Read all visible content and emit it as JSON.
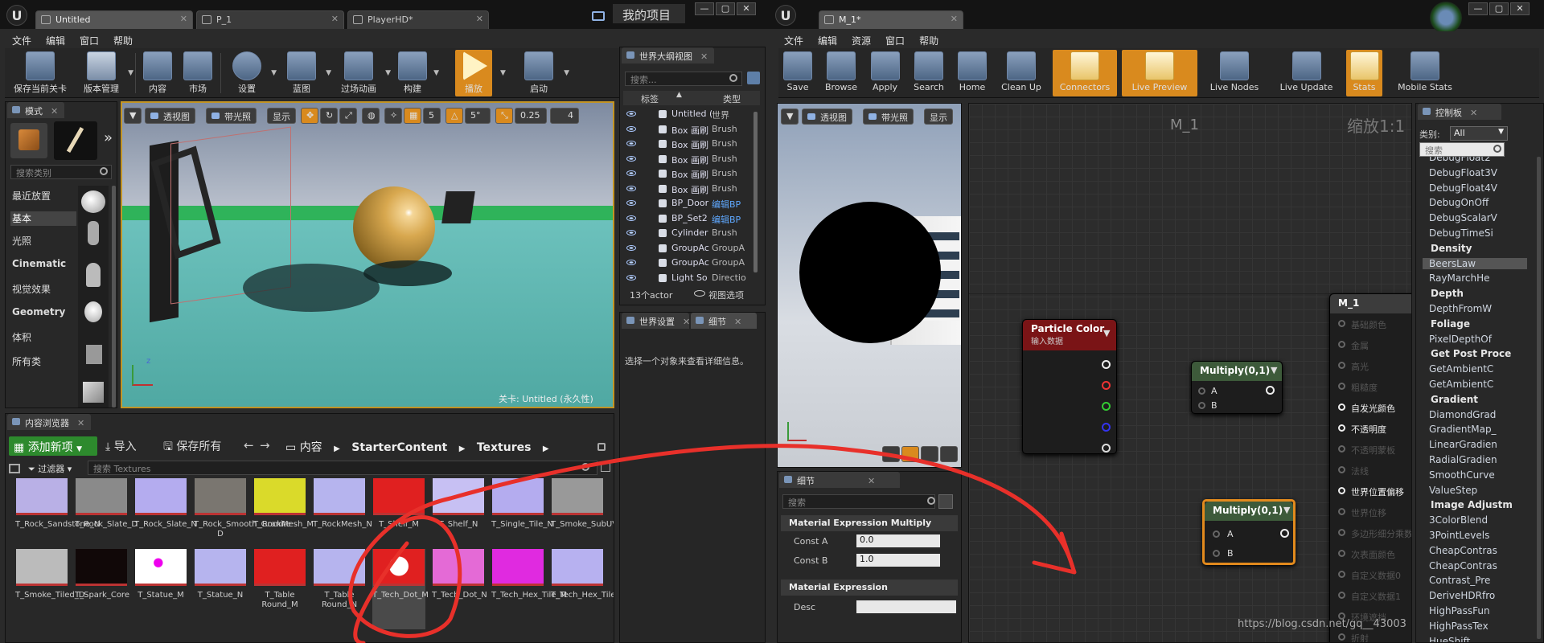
{
  "left_window": {
    "tabs": [
      "Untitled",
      "P_1",
      "PlayerHD*"
    ],
    "project_label": "我的项目",
    "menu": [
      "文件",
      "编辑",
      "窗口",
      "帮助"
    ],
    "toolbar": [
      "保存当前关卡",
      "版本管理",
      "内容",
      "市场",
      "设置",
      "蓝图",
      "过场动画",
      "构建",
      "播放",
      "启动"
    ],
    "modes": {
      "tab": "模式",
      "search_placeholder": "搜索类别",
      "categories": [
        "最近放置",
        "基本",
        "光照",
        "Cinematic",
        "视觉效果",
        "Geometry",
        "体积",
        "所有类"
      ]
    },
    "viewport": {
      "buttons": [
        "透视图",
        "带光照",
        "显示"
      ],
      "snap_values": [
        "5",
        "5°",
        "0.25",
        "4"
      ],
      "level_label": "关卡: Untitled (永久性)"
    },
    "outliner": {
      "tab": "世界大纲视图",
      "search_placeholder": "搜索...",
      "col_label": "标签",
      "col_type": "类型",
      "rows": [
        {
          "name": "Untitled (Edi",
          "type": "世界"
        },
        {
          "name": "Box 画刷",
          "type": "Brush"
        },
        {
          "name": "Box 画刷",
          "type": "Brush"
        },
        {
          "name": "Box 画刷",
          "type": "Brush"
        },
        {
          "name": "Box 画刷",
          "type": "Brush"
        },
        {
          "name": "Box 画刷",
          "type": "Brush"
        },
        {
          "name": "BP_Door",
          "type": "编辑BP"
        },
        {
          "name": "BP_Set2",
          "type": "编辑BP"
        },
        {
          "name": "Cylinder",
          "type": "Brush"
        },
        {
          "name": "GroupAc",
          "type": "GroupA"
        },
        {
          "name": "GroupAc",
          "type": "GroupA"
        },
        {
          "name": "Light So",
          "type": "Directio"
        }
      ],
      "footer_count": "13个actor",
      "footer_view": "视图选项"
    },
    "details": {
      "tab1": "世界设置",
      "tab2": "细节",
      "empty_text": "选择一个对象来查看详细信息。"
    },
    "content_browser": {
      "tab": "内容浏览器",
      "add_new": "添加新项",
      "import": "导入",
      "save_all": "保存所有",
      "path": [
        "内容",
        "StarterContent",
        "Textures"
      ],
      "filter": "过滤器",
      "search_placeholder": "搜索 Textures",
      "row1": [
        "T_Rock_Sandstone_N",
        "T_Rock_Slate_D",
        "T_Rock_Slate_N",
        "T_Rock_Smooth_Granite D",
        "T_RockMesh_M",
        "T_RockMesh_N",
        "T_Shelf_M",
        "T_Shelf_N",
        "T_Single_Tile_N",
        "T_Smoke_SubUV"
      ],
      "row2": [
        "T_Smoke_Tiled_D",
        "T_Spark_Core",
        "T_Statue_M",
        "T_Statue_N",
        "T_Table Round_M",
        "T_Table Round_N",
        "T_Tech_Dot_M",
        "T_Tech_Dot_N",
        "T_Tech_Hex_Tile_M",
        "T_Tech_Hex_Tile_N"
      ]
    }
  },
  "right_window": {
    "tab": "M_1*",
    "menu": [
      "文件",
      "编辑",
      "资源",
      "窗口",
      "帮助"
    ],
    "toolbar": [
      "Save",
      "Browse",
      "Apply",
      "Search",
      "Home",
      "Clean Up",
      "Connectors",
      "Live Preview",
      "Live Nodes",
      "Live Update",
      "Stats",
      "Mobile Stats"
    ],
    "toolbar_active": [
      "Connectors",
      "Live Preview",
      "Stats"
    ],
    "preview_buttons": [
      "透视图",
      "带光照",
      "显示"
    ],
    "graph_title": "M_1",
    "zoom_label": "缩放1:1",
    "details": {
      "tab": "细节",
      "search_placeholder": "搜索",
      "section1": "Material Expression Multiply",
      "const_a_label": "Const A",
      "const_a_value": "0.0",
      "const_b_label": "Const B",
      "const_b_value": "1.0",
      "section2": "Material Expression",
      "desc_label": "Desc"
    },
    "nodes": {
      "particle_color_title": "Particle Color",
      "particle_color_sub": "输入数据",
      "multiply_title": "Multiply(0,1)",
      "pin_a": "A",
      "pin_b": "B",
      "result_title": "M_1",
      "result_pins": [
        "基础颜色",
        "金属",
        "高光",
        "粗糙度",
        "自发光颜色",
        "不透明度",
        "不透明蒙板",
        "法线",
        "世界位置偏移",
        "世界位移",
        "多边形细分乘数",
        "次表面颜色",
        "自定义数据0",
        "自定义数据1",
        "环境遮挡",
        "折射"
      ]
    },
    "palette": {
      "tab": "控制板",
      "category_label": "类别:",
      "category_value": "All",
      "search_placeholder": "搜索",
      "items": [
        {
          "kind": "item",
          "text": "DebugFloat2"
        },
        {
          "kind": "item",
          "text": "DebugFloat3V"
        },
        {
          "kind": "item",
          "text": "DebugFloat4V"
        },
        {
          "kind": "item",
          "text": "DebugOnOff"
        },
        {
          "kind": "item",
          "text": "DebugScalarV"
        },
        {
          "kind": "item",
          "text": "DebugTimeSi"
        },
        {
          "kind": "cat",
          "text": "Density"
        },
        {
          "kind": "sel",
          "text": "BeersLaw"
        },
        {
          "kind": "item",
          "text": "RayMarchHe"
        },
        {
          "kind": "cat",
          "text": "Depth"
        },
        {
          "kind": "item",
          "text": "DepthFromW"
        },
        {
          "kind": "cat",
          "text": "Foliage"
        },
        {
          "kind": "item",
          "text": "PixelDepthOf"
        },
        {
          "kind": "cat",
          "text": "Get Post Proce"
        },
        {
          "kind": "item",
          "text": "GetAmbientC"
        },
        {
          "kind": "item",
          "text": "GetAmbientC"
        },
        {
          "kind": "cat",
          "text": "Gradient"
        },
        {
          "kind": "item",
          "text": "DiamondGrad"
        },
        {
          "kind": "item",
          "text": "GradientMap_"
        },
        {
          "kind": "item",
          "text": "LinearGradien"
        },
        {
          "kind": "item",
          "text": "RadialGradien"
        },
        {
          "kind": "item",
          "text": "SmoothCurve"
        },
        {
          "kind": "item",
          "text": "ValueStep"
        },
        {
          "kind": "cat",
          "text": "Image Adjustm"
        },
        {
          "kind": "item",
          "text": "3ColorBlend"
        },
        {
          "kind": "item",
          "text": "3PointLevels"
        },
        {
          "kind": "item",
          "text": "CheapContras"
        },
        {
          "kind": "item",
          "text": "CheapContras"
        },
        {
          "kind": "item",
          "text": "Contrast_Pre"
        },
        {
          "kind": "item",
          "text": "DeriveHDRfro"
        },
        {
          "kind": "item",
          "text": "HighPassFun"
        },
        {
          "kind": "item",
          "text": "HighPassTex"
        },
        {
          "kind": "item",
          "text": "HueShift"
        }
      ]
    },
    "watermark": "https://blog.csdn.net/gq__43003"
  },
  "colors": {
    "accent_orange": "#e28a1d",
    "annotation_red": "#e8302a",
    "node_red_header": "#7a1416",
    "node_green_header": "#3d5a3a"
  }
}
